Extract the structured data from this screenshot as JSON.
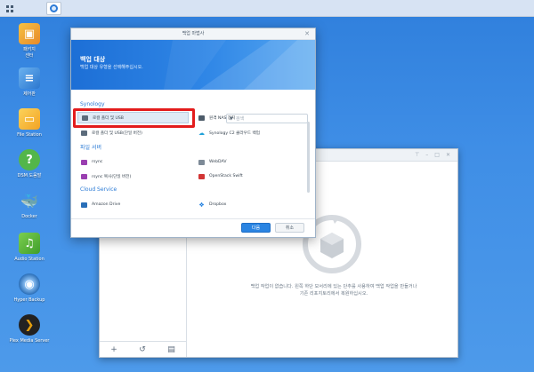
{
  "desktop": {
    "icons": [
      {
        "label": "패키지\n센터",
        "icon": "package-center-icon",
        "color": "#f0a431"
      },
      {
        "label": "제어판",
        "icon": "control-panel-icon",
        "color": "#3c8fe0"
      },
      {
        "label": "File Station",
        "icon": "file-station-icon",
        "color": "#f7b52c"
      },
      {
        "label": "DSM 도움말",
        "icon": "help-icon",
        "color": "#53b64a"
      },
      {
        "label": "Docker",
        "icon": "docker-icon",
        "color": "#2aa3dc"
      },
      {
        "label": "Audio Station",
        "icon": "audio-station-icon",
        "color": "#5cb53d"
      },
      {
        "label": "Hyper Backup",
        "icon": "hyper-backup-icon",
        "color": "#2f6fb8"
      },
      {
        "label": "Plex Media Server",
        "icon": "plex-icon",
        "color": "#1f1f1f"
      }
    ]
  },
  "bg_window": {
    "empty_text": "백업 작업이 없습니다. 왼쪽 하단 모서리에 있는 단추를 사용하여 백업 작업을 만들거나 기존 리포지토리에서 복원하십시오."
  },
  "wizard": {
    "title": "백업 마법사",
    "banner_heading": "백업 대상",
    "banner_sub": "백업 대상 유형을 선택해주십시오.",
    "search_placeholder": "검색",
    "sections": [
      {
        "label": "Synology",
        "items": [
          {
            "label": "로컬 폴더 및 USB",
            "icon": "local-folder-icon",
            "selected": true
          },
          {
            "label": "원격 NAS 장치",
            "icon": "remote-nas-icon"
          },
          {
            "label": "로컬 폴더 및 USB(단일 버전)",
            "icon": "local-folder-single-icon"
          },
          {
            "label": "Synology C2 클라우드 백업",
            "icon": "c2-cloud-icon"
          }
        ]
      },
      {
        "label": "파일 서버",
        "items": [
          {
            "label": "rsync",
            "icon": "rsync-icon"
          },
          {
            "label": "WebDAV",
            "icon": "webdav-icon"
          },
          {
            "label": "rsync 복사(단일 버전)",
            "icon": "rsync-copy-icon"
          },
          {
            "label": "OpenStack Swift",
            "icon": "openstack-icon"
          }
        ]
      },
      {
        "label": "Cloud Service",
        "items": [
          {
            "label": "Amazon Drive",
            "icon": "amazon-drive-icon"
          },
          {
            "label": "Dropbox",
            "icon": "dropbox-icon"
          }
        ]
      }
    ],
    "next_label": "다음",
    "cancel_label": "취소"
  },
  "colors": {
    "accent": "#2a84e2",
    "highlight": "#e31c1c",
    "section": "#2a7ad5"
  }
}
